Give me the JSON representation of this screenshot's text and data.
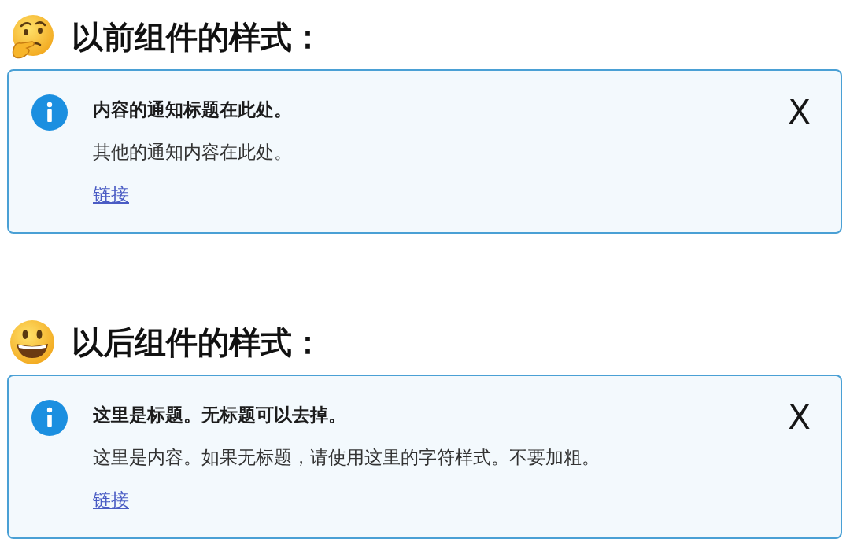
{
  "sections": [
    {
      "heading": "以前组件的样式：",
      "notice": {
        "title": "内容的通知标题在此处。",
        "body": "其他的通知内容在此处。",
        "link": "链接",
        "close": "X"
      }
    },
    {
      "heading": "以后组件的样式：",
      "notice": {
        "title": "这里是标题。无标题可以去掉。",
        "body": "这里是内容。如果无标题，请使用这里的字符样式。不要加粗。",
        "link": "链接",
        "close": "X"
      }
    }
  ]
}
